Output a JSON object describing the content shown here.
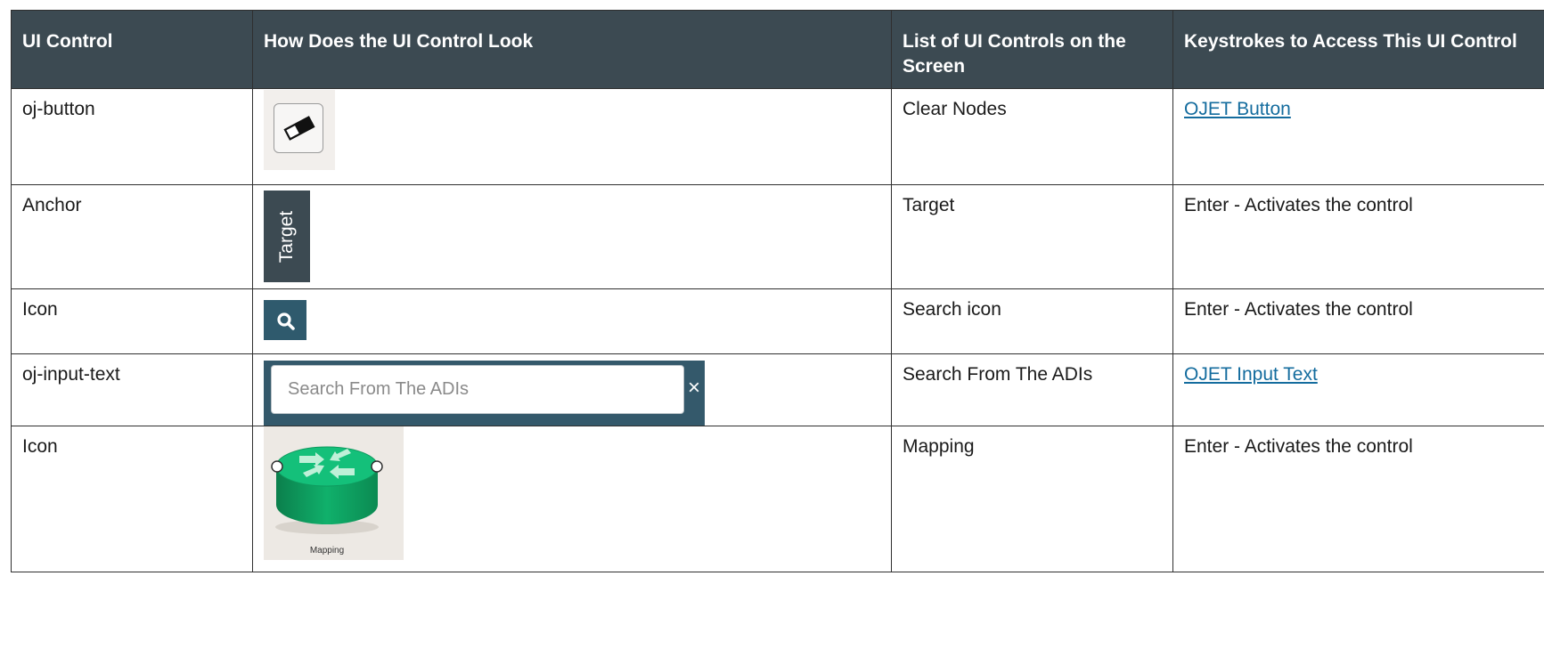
{
  "table": {
    "headers": [
      "UI Control",
      "How Does the UI Control Look",
      "List of UI Controls on the Screen",
      "Keystrokes to Access This UI Control"
    ],
    "rows": [
      {
        "control": "oj-button",
        "sample_icon": "eraser-icon",
        "screen_control": "Clear Nodes",
        "keystrokes": "OJET Button",
        "keystrokes_is_link": true
      },
      {
        "control": "Anchor",
        "sample_label": "Target",
        "screen_control": "Target",
        "keystrokes": "Enter - Activates the control",
        "keystrokes_is_link": false
      },
      {
        "control": "Icon",
        "sample_icon": "search-icon",
        "screen_control": "Search icon",
        "keystrokes": "Enter - Activates the control",
        "keystrokes_is_link": false
      },
      {
        "control": "oj-input-text",
        "sample_placeholder": "Search From The ADIs",
        "sample_clear_glyph": "×",
        "screen_control": "Search From The ADIs",
        "keystrokes": "OJET Input Text",
        "keystrokes_is_link": true
      },
      {
        "control": "Icon",
        "sample_icon": "mapping-icon",
        "sample_caption": "Mapping",
        "screen_control": "Mapping",
        "keystrokes": "Enter - Activates the control",
        "keystrokes_is_link": false
      }
    ]
  },
  "colors": {
    "header_background": "#3c4a52",
    "header_text": "#ffffff",
    "link": "#146c9e",
    "search_bar": "#34596b",
    "mapping_green": "#0fa866"
  }
}
